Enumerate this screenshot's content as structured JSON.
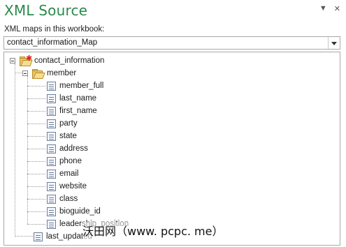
{
  "pane": {
    "title": "XML Source",
    "maps_label": "XML maps in this workbook:",
    "selected_map": "contact_information_Map"
  },
  "icons": {
    "pane_options": "chevron-down-icon",
    "close": "close-icon",
    "root": "folder-root-icon",
    "folder": "folder-open-icon",
    "element": "element-icon"
  },
  "tree": {
    "root_label": "contact_information",
    "member_label": "member",
    "member_children": [
      "member_full",
      "last_name",
      "first_name",
      "party",
      "state",
      "address",
      "phone",
      "email",
      "website",
      "class",
      "bioguide_id",
      "leadership_position"
    ],
    "last_label": "last_updated"
  },
  "watermark": "沃田网（www. pcpc. me）"
}
